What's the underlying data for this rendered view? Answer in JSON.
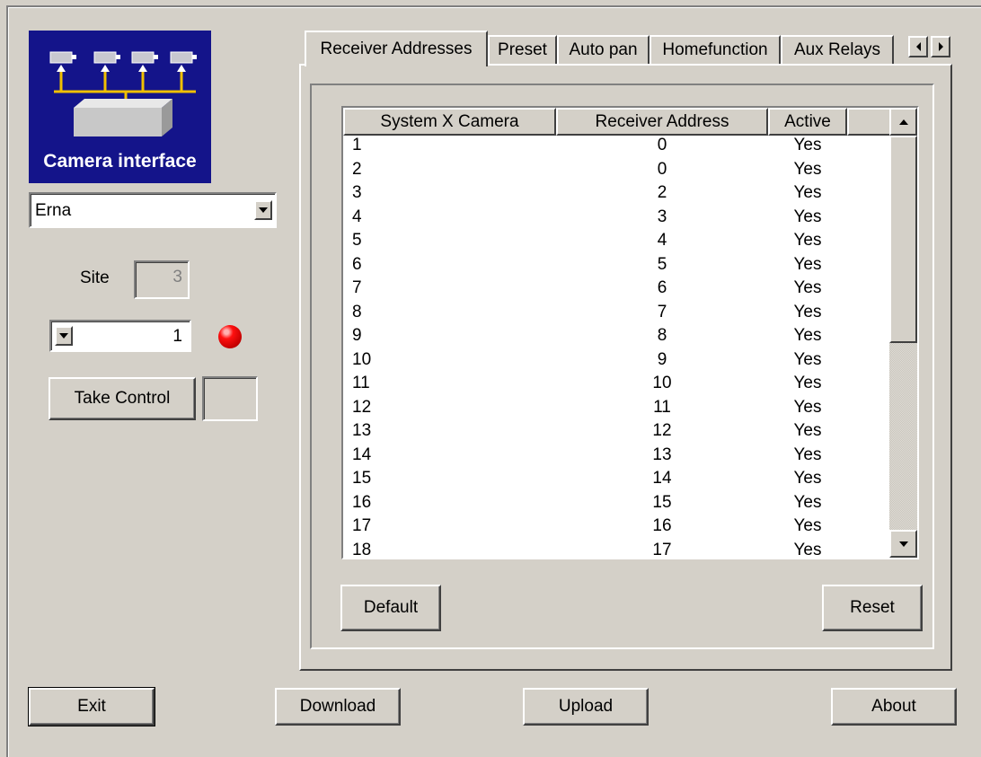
{
  "logo": {
    "caption": "Camera interface",
    "bus_color": "#f0c000",
    "bg_color": "#14148a"
  },
  "site_selector": {
    "value": "Erna"
  },
  "site": {
    "label": "Site",
    "value": "3"
  },
  "camera_selector": {
    "value": "1"
  },
  "status_led": {
    "color": "#ff0000"
  },
  "take_control": {
    "label": "Take Control",
    "field_value": ""
  },
  "tabs": [
    {
      "label": "Receiver Addresses",
      "active": true
    },
    {
      "label": "Preset",
      "active": false
    },
    {
      "label": "Auto pan",
      "active": false
    },
    {
      "label": "Homefunction",
      "active": false
    },
    {
      "label": "Aux Relays",
      "active": false
    }
  ],
  "table": {
    "columns": [
      "System X Camera",
      "Receiver Address",
      "Active"
    ],
    "rows": [
      [
        "1",
        "0",
        "Yes"
      ],
      [
        "2",
        "0",
        "Yes"
      ],
      [
        "3",
        "2",
        "Yes"
      ],
      [
        "4",
        "3",
        "Yes"
      ],
      [
        "5",
        "4",
        "Yes"
      ],
      [
        "6",
        "5",
        "Yes"
      ],
      [
        "7",
        "6",
        "Yes"
      ],
      [
        "8",
        "7",
        "Yes"
      ],
      [
        "9",
        "8",
        "Yes"
      ],
      [
        "10",
        "9",
        "Yes"
      ],
      [
        "11",
        "10",
        "Yes"
      ],
      [
        "12",
        "11",
        "Yes"
      ],
      [
        "13",
        "12",
        "Yes"
      ],
      [
        "14",
        "13",
        "Yes"
      ],
      [
        "15",
        "14",
        "Yes"
      ],
      [
        "16",
        "15",
        "Yes"
      ],
      [
        "17",
        "16",
        "Yes"
      ],
      [
        "18",
        "17",
        "Yes"
      ]
    ]
  },
  "panel_buttons": {
    "default_label": "Default",
    "reset_label": "Reset"
  },
  "bottom_buttons": {
    "exit_label": "Exit",
    "download_label": "Download",
    "upload_label": "Upload",
    "about_label": "About"
  }
}
